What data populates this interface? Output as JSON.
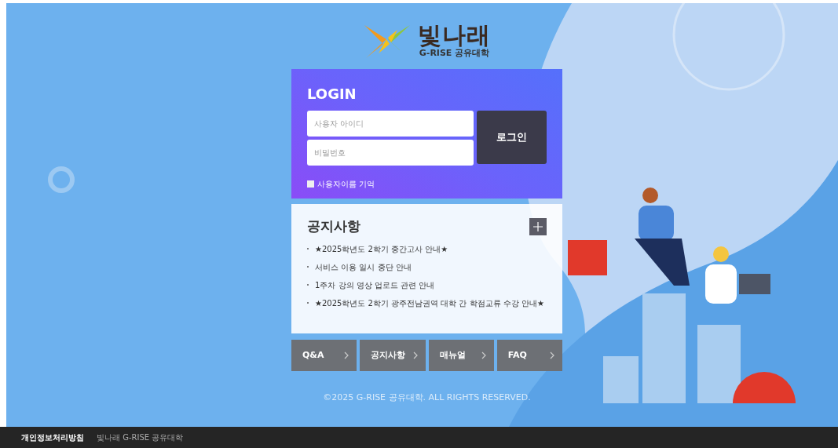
{
  "logo": {
    "name": "빛나래",
    "subtitle": "G-RISE 공유대학"
  },
  "login": {
    "title": "LOGIN",
    "username": {
      "placeholder": "사용자 아이디"
    },
    "password": {
      "placeholder": "비밀번호"
    },
    "submit": "로그인",
    "remember": {
      "label": "사용자이름 기억",
      "checked": false
    }
  },
  "notices": {
    "title": "공지사항",
    "items": [
      {
        "title": "★2025학년도 2학기 중간고사 안내★"
      },
      {
        "title": "서비스 이용 일시 중단 안내"
      },
      {
        "title": "1주차 강의 영상 업로드 관련 안내"
      },
      {
        "title": "★2025학년도 2학기 광주전남권역 대학 간 학점교류 수강 안내★"
      }
    ]
  },
  "quick_links": [
    {
      "label": "Q&A"
    },
    {
      "label": "공지사항"
    },
    {
      "label": "매뉴얼"
    },
    {
      "label": "FAQ"
    }
  ],
  "copyright": "©2025 G-RISE 공유대학. ALL RIGHTS RESERVED.",
  "footer": {
    "policy_link": "개인정보처리방침",
    "text": "빛나래 G-RISE 공유대학"
  }
}
